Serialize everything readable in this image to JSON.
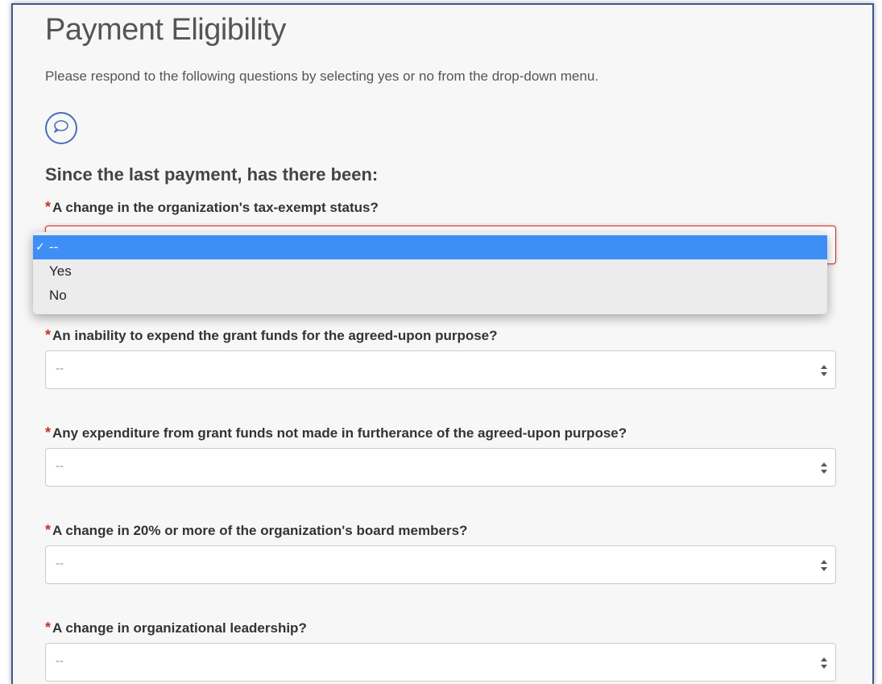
{
  "page": {
    "title": "Payment Eligibility",
    "intro": "Please respond to the following questions by selecting yes or no from the drop-down menu.",
    "section_heading": "Since the last payment, has there been:"
  },
  "required_marker": "*",
  "questions": [
    {
      "label": "A change in the organization's tax-exempt status?",
      "value": "--"
    },
    {
      "label": "An inability to expend the grant funds for the agreed-upon purpose?",
      "value": "--"
    },
    {
      "label": "Any expenditure from grant funds not made in furtherance of the agreed-upon purpose?",
      "value": "--"
    },
    {
      "label": "A change in 20% or more of the organization's board members?",
      "value": "--"
    },
    {
      "label": "A change in organizational leadership?",
      "value": "--"
    }
  ],
  "dropdown": {
    "check_mark": "✓",
    "options": [
      "--",
      "Yes",
      "No"
    ],
    "selected_index": 0
  },
  "colors": {
    "required": "#c9302c",
    "selection_highlight": "#3d8ff5",
    "panel_border": "#3b5a94"
  },
  "icons": [
    "comment-icon",
    "select-arrows-icon",
    "checkmark-icon"
  ]
}
